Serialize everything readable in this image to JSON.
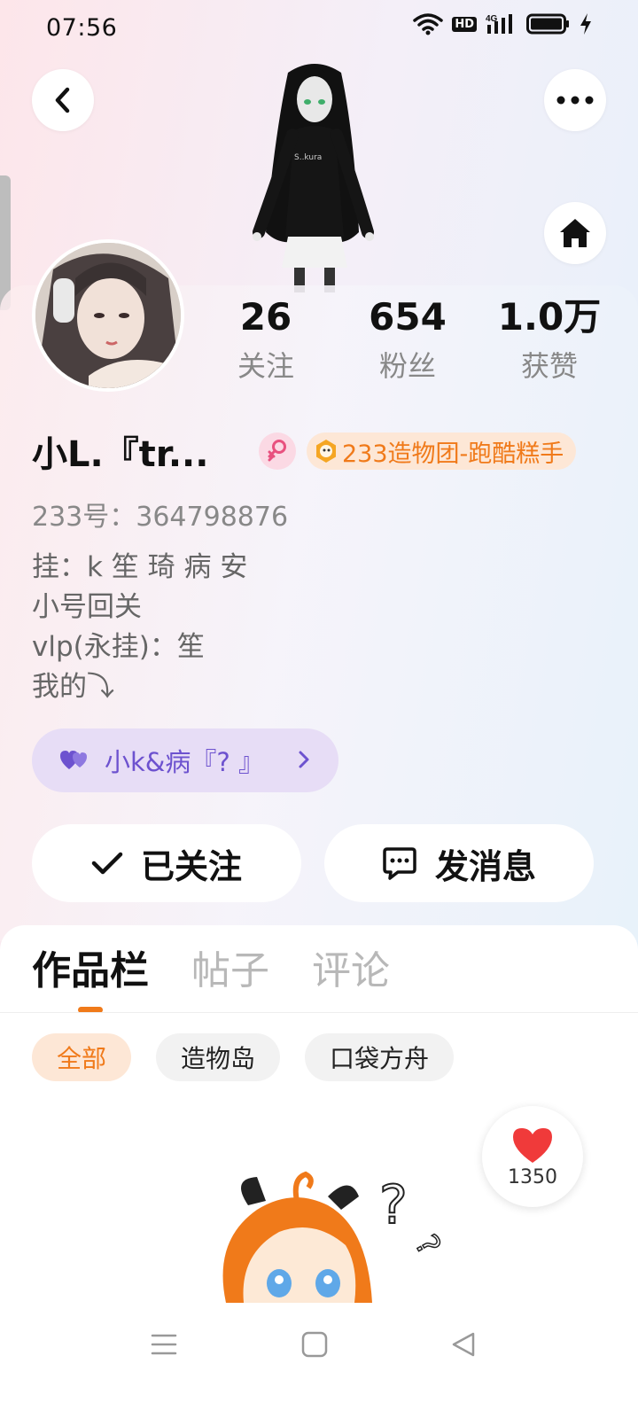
{
  "status_bar": {
    "time": "07:56",
    "network": "4G",
    "hd": "HD",
    "icons": [
      "wifi-icon",
      "hd-icon",
      "signal-icon",
      "battery-icon",
      "charging-icon"
    ]
  },
  "header": {
    "back_icon": "chevron-left-icon",
    "more_icon": "more-dots-icon",
    "home_icon": "home-icon"
  },
  "profile": {
    "stats": [
      {
        "value": "26",
        "label": "关注"
      },
      {
        "value": "654",
        "label": "粉丝"
      },
      {
        "value": "1.0万",
        "label": "获赞"
      }
    ],
    "name": "小L.『tr...",
    "gender_icon": "female-icon",
    "badge": "233造物团-跑酷糕手",
    "uid": "233号：364798876",
    "bio_lines": [
      "挂：k 笙 琦 病 安",
      "小号回关",
      "vlp(永挂)：笙",
      "我的⤵"
    ],
    "group_chip": "小k&病『? 』",
    "follow_button": "已关注",
    "message_button": "发消息"
  },
  "tabs": [
    {
      "label": "作品栏",
      "active": true
    },
    {
      "label": "帖子",
      "active": false
    },
    {
      "label": "评论",
      "active": false
    }
  ],
  "filters": [
    {
      "label": "全部",
      "active": true
    },
    {
      "label": "造物岛",
      "active": false
    },
    {
      "label": "口袋方舟",
      "active": false
    }
  ],
  "like_bubble": {
    "count": "1350"
  },
  "colors": {
    "accent": "#f07a1a",
    "group_purple": "#6d52cf",
    "heart_red": "#f03a3a"
  },
  "nav_icons": [
    "menu-icon",
    "home-square-icon",
    "back-triangle-icon"
  ]
}
